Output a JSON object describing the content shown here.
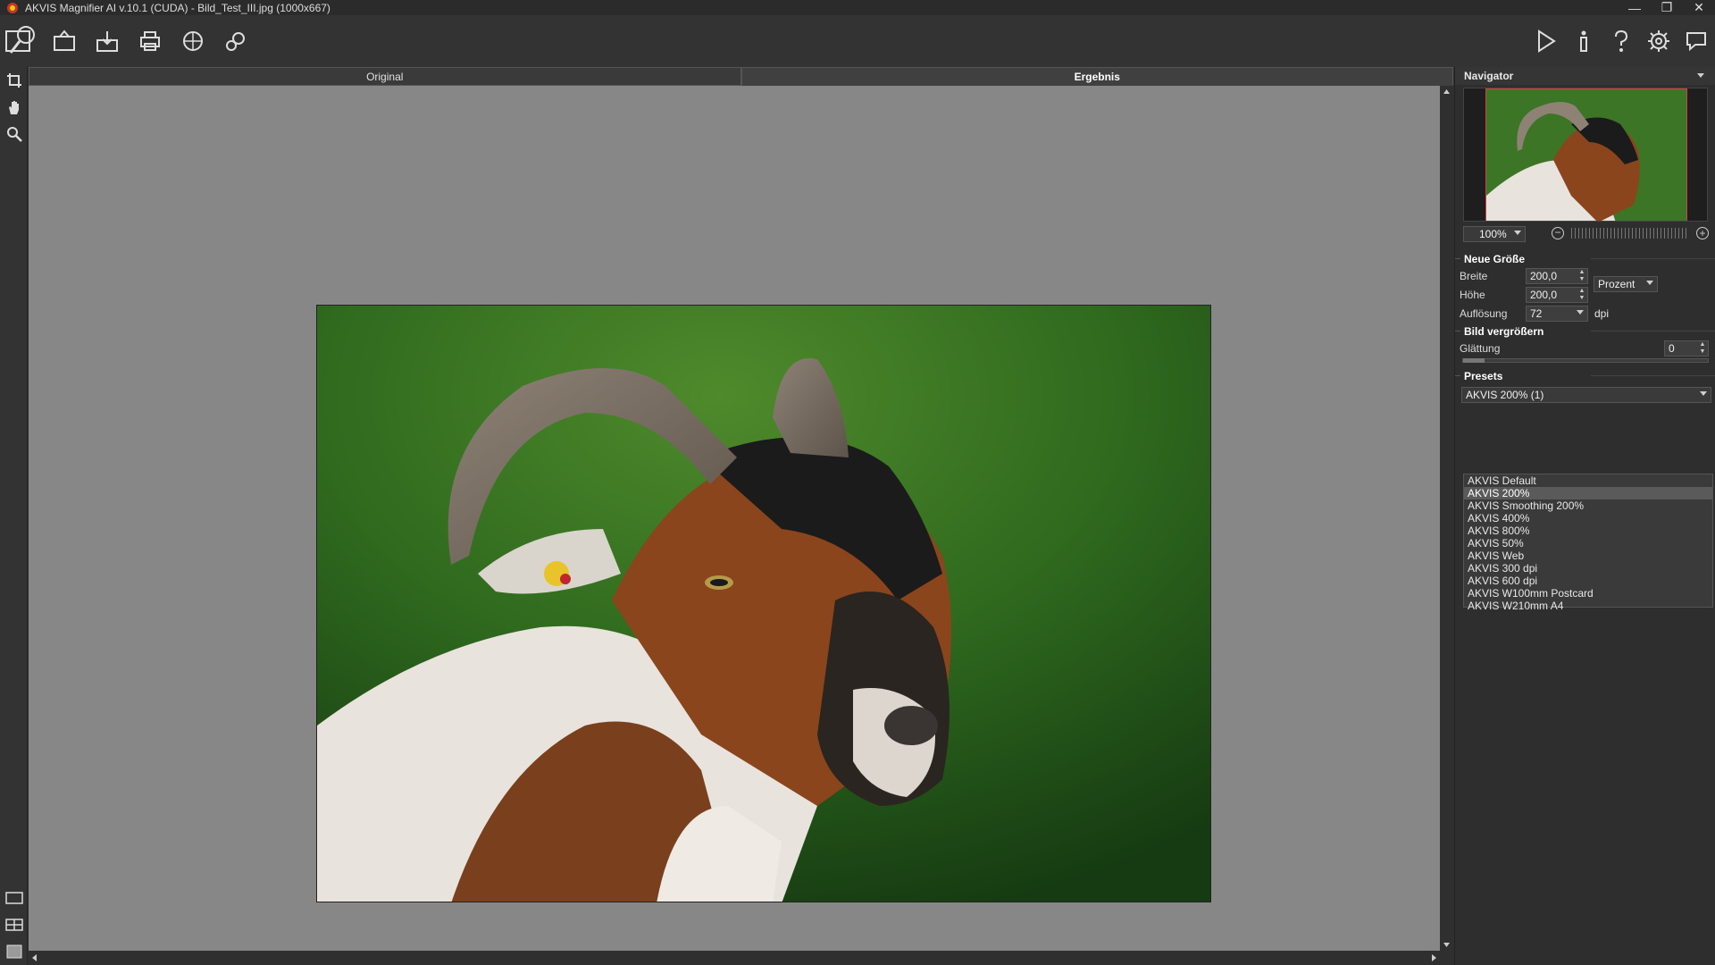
{
  "window": {
    "title": "AKVIS Magnifier AI v.10.1 (CUDA) - Bild_Test_III.jpg (1000x667)",
    "minimize": "—",
    "maximize": "❐",
    "close": "✕"
  },
  "toolbar": {
    "left_icons": [
      "open-image-icon",
      "save-image-icon",
      "print-icon",
      "share-icon",
      "batch-settings-icon"
    ],
    "right_icons": [
      "run-icon",
      "info-icon",
      "help-icon",
      "preferences-icon",
      "comment-icon"
    ]
  },
  "tabs": {
    "original": "Original",
    "ergebnis": "Ergebnis"
  },
  "navigator": {
    "title": "Navigator",
    "zoom": "100%"
  },
  "new_size": {
    "title": "Neue Größe",
    "width_label": "Breite",
    "width_value": "200,0",
    "height_label": "Höhe",
    "height_value": "200,0",
    "unit": "Prozent",
    "resolution_label": "Auflösung",
    "resolution_value": "72",
    "resolution_unit": "dpi"
  },
  "enlarge": {
    "title": "Bild vergrößern",
    "smoothing_label": "Glättung",
    "smoothing_value": "0"
  },
  "presets": {
    "title": "Presets",
    "selected": "AKVIS 200% (1)",
    "items": [
      "AKVIS Default",
      "AKVIS 200%",
      "AKVIS Smoothing 200%",
      "AKVIS 400%",
      "AKVIS 800%",
      "AKVIS 50%",
      "AKVIS Web",
      "AKVIS 300 dpi",
      "AKVIS 600 dpi",
      "AKVIS W100mm Postcard",
      "AKVIS W210mm A4"
    ],
    "highlighted_index": 1
  },
  "colors": {
    "canvas_bg": "#878787",
    "panel_bg": "#2e2e2e",
    "selection": "#5a5a5a"
  }
}
